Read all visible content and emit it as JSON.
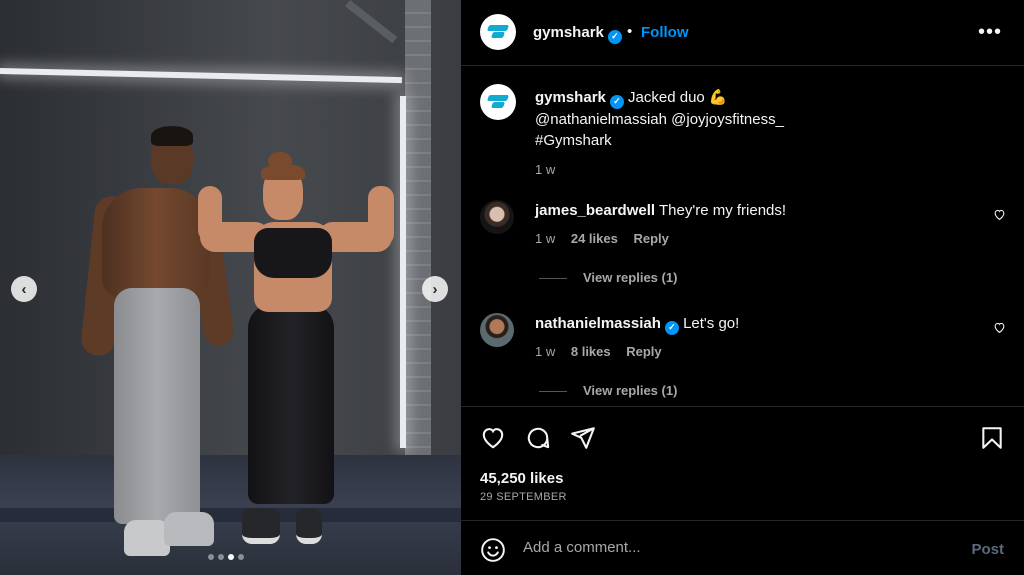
{
  "header": {
    "username": "gymshark",
    "separator": "•",
    "follow_label": "Follow",
    "more_label": "•••"
  },
  "media": {
    "prev_arrow": "‹",
    "next_arrow": "›",
    "slide_count": 4,
    "active_slide": 3
  },
  "caption": {
    "username": "gymshark",
    "text": "Jacked duo 💪",
    "mentions": "@nathanielmassiah @joyjoysfitness_",
    "hashtag": "#Gymshark",
    "time": "1 w"
  },
  "comments": [
    {
      "username": "james_beardwell",
      "verified": false,
      "text": "They're my friends!",
      "time": "1 w",
      "likes": "24 likes",
      "reply_label": "Reply",
      "view_replies": "View replies (1)"
    },
    {
      "username": "nathanielmassiah",
      "verified": true,
      "text": "Let's go!",
      "time": "1 w",
      "likes": "8 likes",
      "reply_label": "Reply",
      "view_replies": "View replies (1)"
    }
  ],
  "actions": {
    "icons": [
      "heart-icon",
      "comment-icon",
      "share-icon",
      "bookmark-icon"
    ]
  },
  "stats": {
    "likes": "45,250 likes",
    "date": "29 SEPTEMBER"
  },
  "composer": {
    "placeholder": "Add a comment...",
    "post_label": "Post"
  },
  "colors": {
    "background": "#000000",
    "accent": "#0095f6",
    "muted_text": "#a8a8a8",
    "post_disabled": "#5c6a80"
  }
}
